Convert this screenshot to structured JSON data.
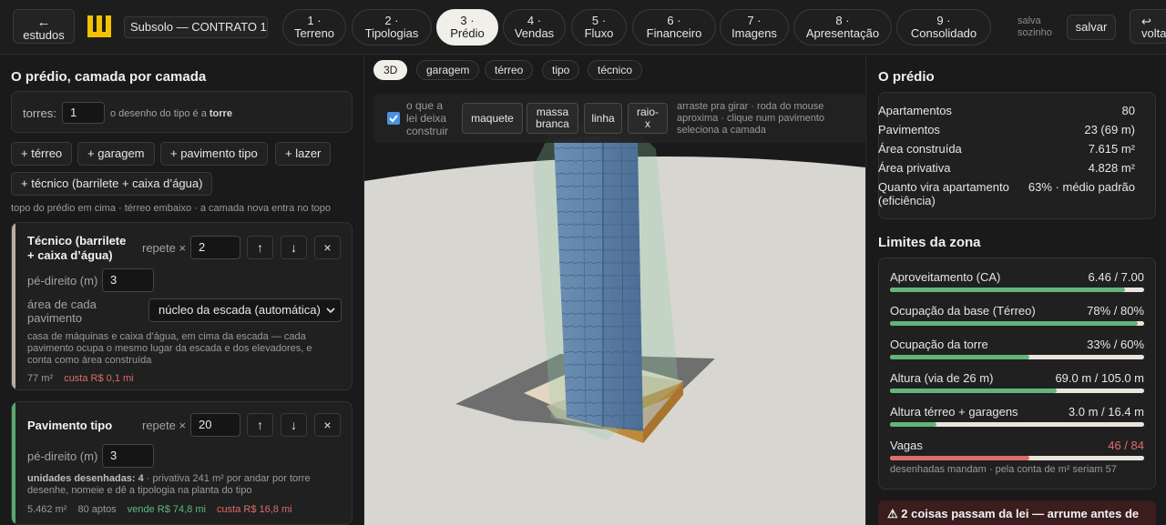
{
  "topbar": {
    "back_arrow": "←",
    "back_label": "estudos",
    "project_name": "Subsolo — CONTRATO 1",
    "steps": [
      {
        "num": "1 ·",
        "label": "Terreno"
      },
      {
        "num": "2 ·",
        "label": "Tipologias"
      },
      {
        "num": "3 ·",
        "label": "Prédio"
      },
      {
        "num": "4 ·",
        "label": "Vendas"
      },
      {
        "num": "5 ·",
        "label": "Fluxo"
      },
      {
        "num": "6 ·",
        "label": "Financeiro"
      },
      {
        "num": "7 ·",
        "label": "Imagens"
      },
      {
        "num": "8 ·",
        "label": "Apresentação"
      },
      {
        "num": "9 ·",
        "label": "Consolidado"
      }
    ],
    "active_step": 3,
    "autosave_line1": "salva",
    "autosave_line2": "sozinho",
    "save_label": "salvar",
    "voltar_arrow": "↩",
    "voltar_label": "voltar"
  },
  "left": {
    "title": "O prédio, camada por camada",
    "torres_label": "torres:",
    "torres_value": "1",
    "torres_hint_prefix": "o desenho do tipo é a ",
    "torres_hint_bold": "torre",
    "add_buttons": [
      "+ térreo",
      "+ garagem",
      "+ pavimento tipo",
      "+ lazer",
      "+ técnico (barrilete + caixa d’água)"
    ],
    "order_hint": "topo do prédio em cima · térreo embaixo · a camada nova entra no topo",
    "layers": [
      {
        "title_line1": "Técnico (barrilete",
        "title_line2": "+ caixa d’água)",
        "repeat_label": "repete ×",
        "repeat_value": "2",
        "pd_label": "pé-direito (m)",
        "pd_value": "3",
        "area_label_line1": "área de cada",
        "area_label_line2": "pavimento",
        "area_select": "núcleo da escada (automática)",
        "desc": "casa de máquinas e caixa d’água, em cima da escada — cada pavimento ocupa o mesmo lugar da escada e dos elevadores, e conta como área construída",
        "area": "77 m²",
        "cost": "custa R$ 0,1 mi",
        "stripe": "#b9ada0"
      },
      {
        "title_line1": "Pavimento tipo",
        "repeat_label": "repete ×",
        "repeat_value": "20",
        "pd_label": "pé-direito (m)",
        "pd_value": "3",
        "units_bold": "unidades desenhadas: 4",
        "units_rest": " · privativa 241 m² por andar por torre",
        "units_line2": "desenhe, nomeie e dê a tipologia na planta do tipo",
        "area": "5.462 m²",
        "aptos": "80 aptos",
        "sell": "vende R$ 74,8 mi",
        "cost": "custa R$ 16,8 mi",
        "stripe": "#5aa870"
      }
    ],
    "icons": {
      "up": "↑",
      "down": "↓",
      "remove": "×"
    }
  },
  "center": {
    "tabs": [
      "3D",
      "garagem",
      "térreo",
      "tipo",
      "técnico"
    ],
    "active_tab": "3D",
    "overlay": {
      "checkbox_label_l1": "o que a",
      "checkbox_label_l2": "lei deixa",
      "checkbox_label_l3": "construir",
      "checked": true,
      "modes": [
        {
          "l1": "maquete",
          "l2": ""
        },
        {
          "l1": "massa",
          "l2": "branca"
        },
        {
          "l1": "linha",
          "l2": ""
        },
        {
          "l1": "raio-",
          "l2": "x"
        }
      ],
      "hint": "arraste pra girar · roda do mouse aproxima · clique num pavimento seleciona a camada"
    }
  },
  "right": {
    "title": "O prédio",
    "summary": [
      {
        "label": "Apartamentos",
        "value": "80"
      },
      {
        "label": "Pavimentos",
        "value": "23 (69 m)"
      },
      {
        "label": "Área construída",
        "value": "7.615 m²"
      },
      {
        "label": "Área privativa",
        "value": "4.828 m²"
      },
      {
        "label": "Quanto vira apartamento",
        "label2": "(eficiência)",
        "value": "63% · médio padrão"
      }
    ],
    "limits_title": "Limites da zona",
    "limits": [
      {
        "label": "Aproveitamento (CA)",
        "value": "6.46 / 7.00",
        "fraction": 0.923,
        "color": "#62b57a",
        "value_color": "#e6e6e6"
      },
      {
        "label": "Ocupação da base (Térreo)",
        "value": "78% / 80%",
        "fraction": 0.975,
        "color": "#62b57a",
        "value_color": "#e6e6e6"
      },
      {
        "label": "Ocupação da torre",
        "value": "33% / 60%",
        "fraction": 0.55,
        "color": "#62b57a",
        "value_color": "#e6e6e6"
      },
      {
        "label": "Altura (via de 26 m)",
        "value": "69.0 m / 105.0 m",
        "fraction": 0.657,
        "color": "#62b57a",
        "value_color": "#e6e6e6"
      },
      {
        "label": "Altura térreo + garagens",
        "value": "3.0 m / 16.4 m",
        "fraction": 0.183,
        "color": "#62b57a",
        "value_color": "#e6e6e6"
      },
      {
        "label": "Vagas",
        "value": "46 / 84",
        "fraction": 0.548,
        "color": "#e06b6b",
        "value_color": "#e06b6b"
      }
    ],
    "vagas_note": "desenhadas mandam · pela conta de m² seriam 57",
    "alert": "⚠ 2 coisas passam da lei — arrume antes de"
  },
  "colors": {
    "accent_yellow": "#f2c200",
    "ok": "#62b57a",
    "bad": "#e06b6b"
  }
}
